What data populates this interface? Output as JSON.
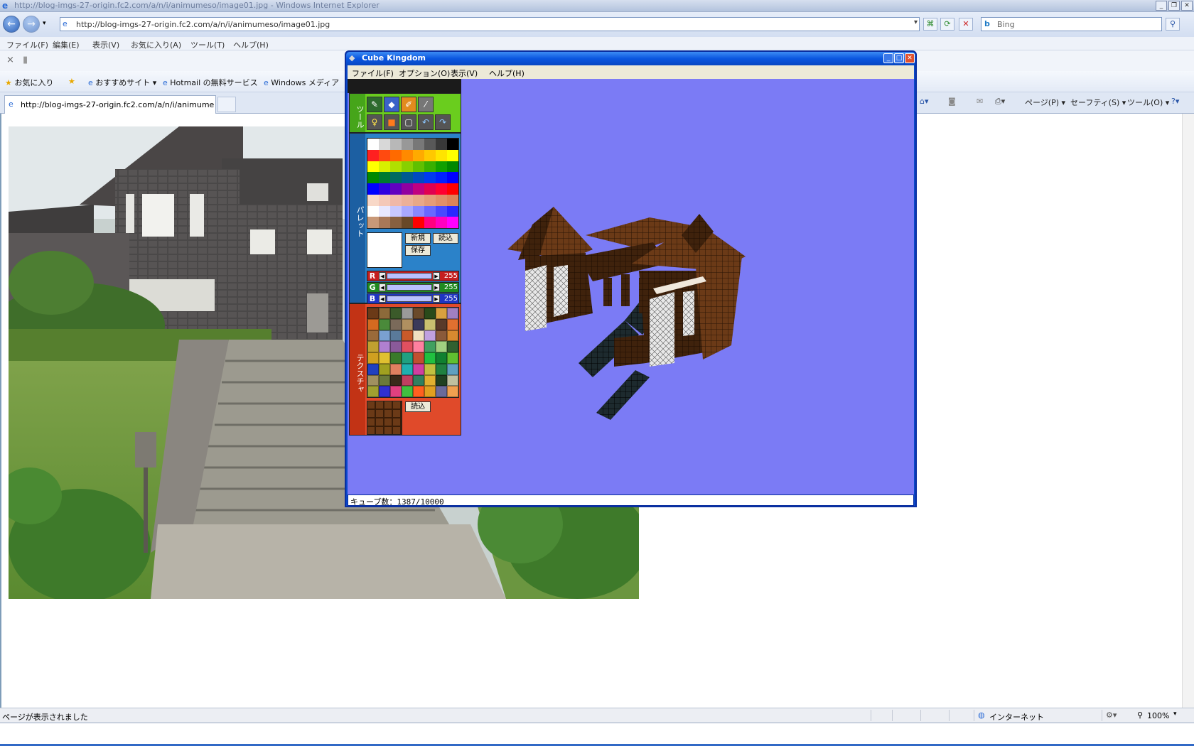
{
  "browser": {
    "title": "http://blog-imgs-27-origin.fc2.com/a/n/i/animumeso/image01.jpg - Windows Internet Explorer",
    "address": "http://blog-imgs-27-origin.fc2.com/a/n/i/animumeso/image01.jpg",
    "search_placeholder": "Bing",
    "menu": [
      "ファイル(F)",
      "編集(E)",
      "表示(V)",
      "お気に入り(A)",
      "ツール(T)",
      "ヘルプ(H)"
    ],
    "favorites": {
      "label": "お気に入り",
      "items": [
        "おすすめサイト ▾",
        "Hotmail の無料サービス",
        "Windows メディア"
      ]
    },
    "tab_label": "http://blog-imgs-27-origin.fc2.com/a/n/i/animume...",
    "command_bar": [
      "ページ(P) ▾",
      "セーフティ(S) ▾",
      "ツール(O) ▾"
    ],
    "status_text": "ページが表示されました",
    "zone": "インターネット",
    "zoom": "100%"
  },
  "app": {
    "title": "Cube Kingdom",
    "menu": [
      "ファイル(F)",
      "オプション(O)",
      "表示(V)",
      "ヘルプ(H)"
    ],
    "sections": {
      "tool": "ツール",
      "palette": "パレット",
      "texture": "テクスチャ"
    },
    "buttons": {
      "new": "新規",
      "load": "読込",
      "save": "保存",
      "tex_load": "読込"
    },
    "rgb": {
      "r_label": "R",
      "g_label": "G",
      "b_label": "B",
      "r": "255",
      "g": "255",
      "b": "255"
    },
    "status": "キューブ数：1387/10000"
  },
  "colors": {
    "viewport_bg": "#7b7bf5",
    "window_frame": "#0a47c9",
    "tool_green": "#6acd1e",
    "palette_blue": "#2b82c9",
    "texture_red": "#e04a2a",
    "cube_brown": "#6b3a17"
  },
  "icons": [
    "back-icon",
    "forward-icon",
    "ie-icon",
    "refresh-icon",
    "stop-icon",
    "search-icon",
    "star-icon",
    "home-icon",
    "print-icon",
    "help-icon",
    "pencil-icon",
    "eraser-icon",
    "brush-icon",
    "eyedropper-icon",
    "bulb-icon",
    "cube-icon",
    "wireframe-cube-icon",
    "undo-icon",
    "redo-icon",
    "globe-icon",
    "zoom-icon"
  ]
}
